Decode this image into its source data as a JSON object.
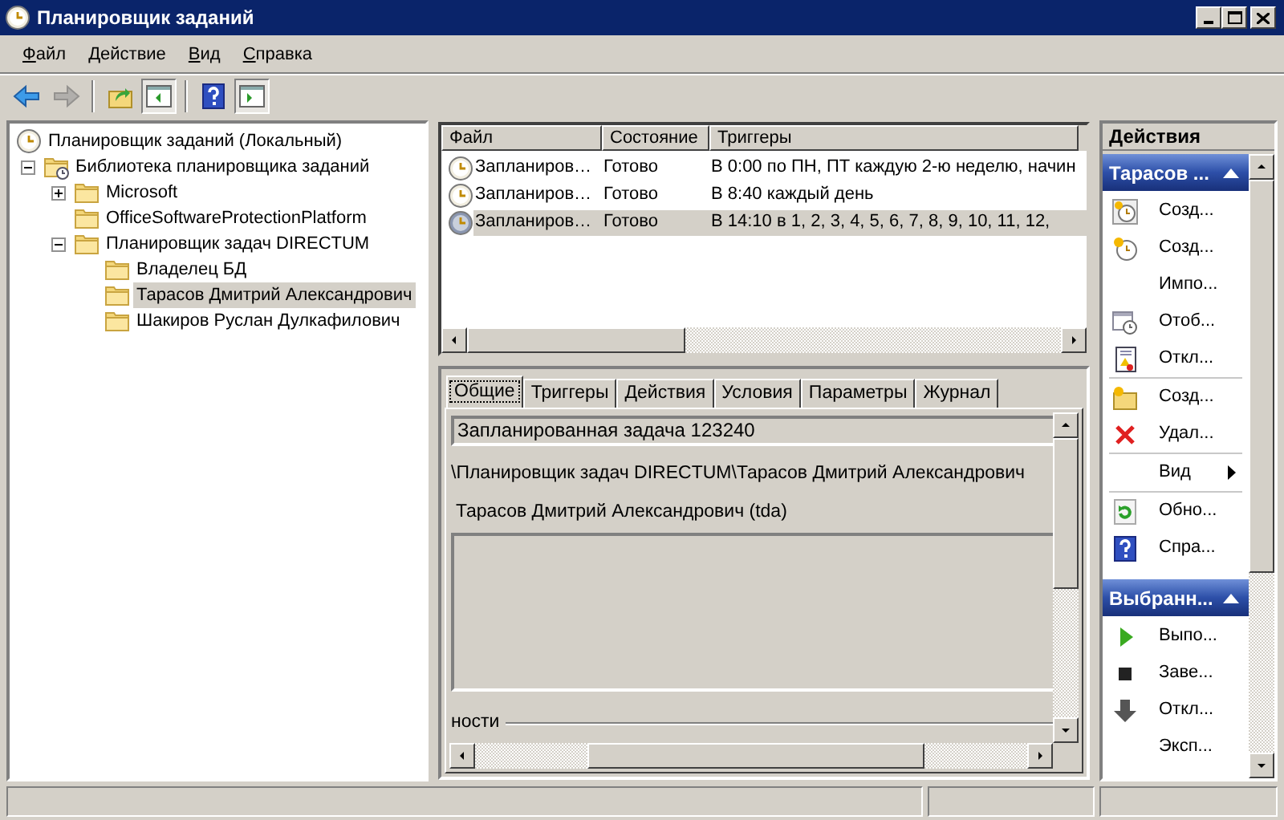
{
  "window": {
    "title": "Планировщик заданий"
  },
  "menu": [
    "Файл",
    "Действие",
    "Вид",
    "Справка"
  ],
  "toolbar": [
    {
      "kind": "back",
      "disabled": false,
      "pressed": false
    },
    {
      "kind": "forward",
      "disabled": true,
      "pressed": false
    },
    {
      "kind": "separator"
    },
    {
      "kind": "up",
      "disabled": false,
      "pressed": false
    },
    {
      "kind": "tree_toggle",
      "disabled": false,
      "pressed": true
    },
    {
      "kind": "separator"
    },
    {
      "kind": "help",
      "disabled": false,
      "pressed": false
    },
    {
      "kind": "actions_toggle",
      "disabled": false,
      "pressed": true
    }
  ],
  "tree": {
    "label": "Планировщик заданий (Локальный)",
    "selected": false,
    "children": [
      {
        "label": "Библиотека планировщика заданий",
        "selected": false,
        "expanded": true,
        "children": [
          {
            "label": "Microsoft",
            "selected": false,
            "expanded": false
          },
          {
            "label": "OfficeSoftwareProtectionPlatform",
            "selected": false
          },
          {
            "label": "Планировщик задач DIRECTUM",
            "selected": false,
            "expanded": true,
            "children": [
              {
                "label": "Владелец БД",
                "selected": false
              },
              {
                "label": "Тарасов Дмитрий Александрович",
                "selected": true
              },
              {
                "label": "Шакиров Руслан Дулкафилович",
                "selected": false
              }
            ]
          }
        ]
      }
    ]
  },
  "task_table": {
    "columns": [
      "Файл",
      "Состояние",
      "Триггеры"
    ],
    "rows": [
      {
        "cells": [
          "Запланиров…",
          "Готово",
          "В 0:00 по ПН, ПТ каждую 2-ю неделю, начин"
        ],
        "selected": false
      },
      {
        "cells": [
          "Запланиров…",
          "Готово",
          "В 8:40 каждый день"
        ],
        "selected": false
      },
      {
        "cells": [
          "Запланиров…",
          "Готово",
          "В 14:10 в 1, 2, 3, 4, 5, 6, 7, 8, 9, 10, 11, 12,"
        ],
        "selected": true
      }
    ]
  },
  "detail_tabs": [
    {
      "label": "Общие",
      "selected": true
    },
    {
      "label": "Триггеры",
      "selected": false
    },
    {
      "label": "Действия",
      "selected": false
    },
    {
      "label": "Условия",
      "selected": false
    },
    {
      "label": "Параметры",
      "selected": false
    },
    {
      "label": "Журнал",
      "selected": false
    }
  ],
  "general": {
    "name": "Запланированная задача 123240",
    "location": "\\Планировщик задач DIRECTUM\\Тарасов Дмитрий Александрович",
    "author": "Тарасов Дмитрий Александрович (tda)",
    "section": "ности"
  },
  "actions": {
    "title": "Действия",
    "groups": [
      {
        "title": "Тарасов ...",
        "items": [
          {
            "kind": "action",
            "label": "Созд..."
          },
          {
            "kind": "action",
            "label": "Созд..."
          },
          {
            "kind": "action",
            "label": "Импо..."
          },
          {
            "kind": "action",
            "label": "Отоб..."
          },
          {
            "kind": "action",
            "label": "Откл..."
          },
          {
            "kind": "separator"
          },
          {
            "kind": "action",
            "label": "Созд..."
          },
          {
            "kind": "action",
            "label": "Удал..."
          },
          {
            "kind": "separator"
          },
          {
            "kind": "submenu",
            "label": "Вид"
          },
          {
            "kind": "separator"
          },
          {
            "kind": "action",
            "label": "Обно..."
          },
          {
            "kind": "action",
            "label": "Спра..."
          }
        ]
      },
      {
        "title": "Выбранн...",
        "items": [
          {
            "kind": "action",
            "label": "Выпо..."
          },
          {
            "kind": "action",
            "label": "Заве..."
          },
          {
            "kind": "action",
            "label": "Откл..."
          },
          {
            "kind": "action",
            "label": "Эксп..."
          }
        ]
      }
    ]
  }
}
